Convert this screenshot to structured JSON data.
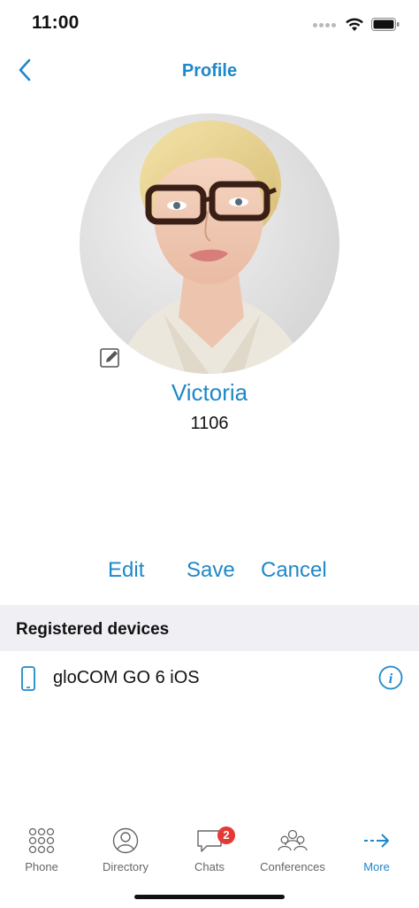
{
  "status_bar": {
    "time": "11:00"
  },
  "nav": {
    "title": "Profile",
    "back_icon": "chevron-left-icon"
  },
  "profile": {
    "name": "Victoria",
    "extension": "1106"
  },
  "actions": {
    "edit": "Edit",
    "save": "Save",
    "cancel": "Cancel"
  },
  "registered_devices": {
    "title": "Registered devices",
    "items": [
      {
        "name": "gloCOM GO 6 iOS",
        "icon": "mobile-phone-icon"
      }
    ]
  },
  "tab_bar": {
    "items": [
      {
        "label": "Phone",
        "icon": "dialpad-icon"
      },
      {
        "label": "Directory",
        "icon": "contact-icon"
      },
      {
        "label": "Chats",
        "icon": "chat-bubble-icon",
        "badge": "2"
      },
      {
        "label": "Conferences",
        "icon": "group-icon"
      },
      {
        "label": "More",
        "icon": "arrow-right-icon",
        "active": true
      }
    ]
  },
  "colors": {
    "accent": "#1e88c9",
    "badge": "#e53935",
    "section_bg": "#efeff4"
  }
}
